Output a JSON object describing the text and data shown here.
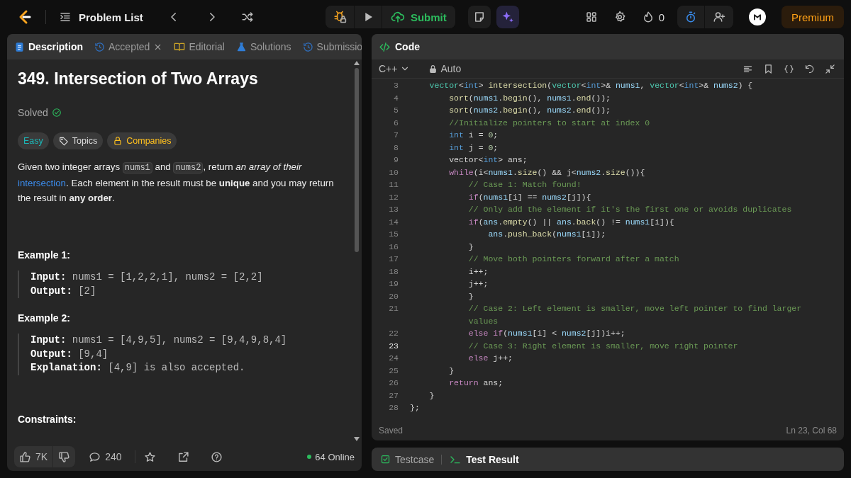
{
  "nav": {
    "problem_list": "Problem List",
    "submit": "Submit",
    "streak": "0",
    "premium": "Premium"
  },
  "description_panel": {
    "tabs": [
      {
        "label": "Description",
        "kind": "description",
        "selected": true,
        "closable": false
      },
      {
        "label": "Accepted",
        "kind": "accepted",
        "selected": false,
        "closable": true
      },
      {
        "label": "Editorial",
        "kind": "editorial",
        "selected": false,
        "closable": false
      },
      {
        "label": "Solutions",
        "kind": "solutions",
        "selected": false,
        "closable": false
      },
      {
        "label": "Submissio",
        "kind": "submissions",
        "selected": false,
        "closable": false
      }
    ],
    "title": "349. Intersection of Two Arrays",
    "status": "Solved",
    "tags": [
      {
        "label": "Easy",
        "kind": "difficulty"
      },
      {
        "label": "Topics",
        "kind": "topics"
      },
      {
        "label": "Companies",
        "kind": "companies"
      }
    ],
    "statement": [
      {
        "kind": "text",
        "text": "Given two integer arrays "
      },
      {
        "kind": "code",
        "text": "nums1"
      },
      {
        "kind": "text",
        "text": " and "
      },
      {
        "kind": "code",
        "text": "nums2"
      },
      {
        "kind": "text",
        "text": ", return *an array of their* "
      },
      {
        "kind": "link",
        "text": "intersection"
      },
      {
        "kind": "text",
        "text": ". Each element in the result must be **unique** and you may return the result in **any order**."
      }
    ],
    "examples": [
      {
        "heading": "Example 1:",
        "lines": [
          "**Input:** nums1 = [1,2,2,1], nums2 = [2,2]",
          "**Output:** [2]"
        ]
      },
      {
        "heading": "Example 2:",
        "lines": [
          "**Input:** nums1 = [4,9,5], nums2 = [9,4,9,8,4]",
          "**Output:** [9,4]",
          "**Explanation:** [4,9] is also accepted."
        ]
      }
    ],
    "constraints_heading": "Constraints:",
    "footer": {
      "likes": "7K",
      "comments": "240",
      "online": "64 Online"
    }
  },
  "code_panel": {
    "tab": "Code",
    "language": "C++",
    "mode": "Auto",
    "status": "Saved",
    "cursor": "Ln 23, Col 68",
    "lines": [
      {
        "number": "3",
        "active": false,
        "tokens": [
          {
            "text": "    vector",
            "kind": "type"
          },
          {
            "text": "<",
            "kind": "plain"
          },
          {
            "text": "int",
            "kind": "keyword"
          },
          {
            "text": "> ",
            "kind": "plain"
          },
          {
            "text": "intersection",
            "kind": "function"
          },
          {
            "text": "(",
            "kind": "plain"
          },
          {
            "text": "vector",
            "kind": "type"
          },
          {
            "text": "<",
            "kind": "plain"
          },
          {
            "text": "int",
            "kind": "keyword"
          },
          {
            "text": ">& ",
            "kind": "plain"
          },
          {
            "text": "nums1",
            "kind": "variable"
          },
          {
            "text": ", ",
            "kind": "plain"
          },
          {
            "text": "vector",
            "kind": "type"
          },
          {
            "text": "<",
            "kind": "plain"
          },
          {
            "text": "int",
            "kind": "keyword"
          },
          {
            "text": ">& ",
            "kind": "plain"
          },
          {
            "text": "nums2",
            "kind": "variable"
          },
          {
            "text": ") {",
            "kind": "plain"
          }
        ]
      },
      {
        "number": "4",
        "active": false,
        "tokens": [
          {
            "text": "        sort",
            "kind": "function"
          },
          {
            "text": "(",
            "kind": "plain"
          },
          {
            "text": "nums1",
            "kind": "variable"
          },
          {
            "text": ".",
            "kind": "plain"
          },
          {
            "text": "begin",
            "kind": "function"
          },
          {
            "text": "(), ",
            "kind": "plain"
          },
          {
            "text": "nums1",
            "kind": "variable"
          },
          {
            "text": ".",
            "kind": "plain"
          },
          {
            "text": "end",
            "kind": "function"
          },
          {
            "text": "());",
            "kind": "plain"
          }
        ]
      },
      {
        "number": "5",
        "active": false,
        "tokens": [
          {
            "text": "        sort",
            "kind": "function"
          },
          {
            "text": "(",
            "kind": "plain"
          },
          {
            "text": "nums2",
            "kind": "variable"
          },
          {
            "text": ".",
            "kind": "plain"
          },
          {
            "text": "begin",
            "kind": "function"
          },
          {
            "text": "(), ",
            "kind": "plain"
          },
          {
            "text": "nums2",
            "kind": "variable"
          },
          {
            "text": ".",
            "kind": "plain"
          },
          {
            "text": "end",
            "kind": "function"
          },
          {
            "text": "());",
            "kind": "plain"
          }
        ]
      },
      {
        "number": "6",
        "active": false,
        "tokens": [
          {
            "text": "        //Initialize pointers to start at index 0",
            "kind": "comment"
          }
        ]
      },
      {
        "number": "7",
        "active": false,
        "tokens": [
          {
            "text": "        int",
            "kind": "keyword"
          },
          {
            "text": " i = ",
            "kind": "plain"
          },
          {
            "text": "0",
            "kind": "number"
          },
          {
            "text": ";",
            "kind": "plain"
          }
        ]
      },
      {
        "number": "8",
        "active": false,
        "tokens": [
          {
            "text": "        int",
            "kind": "keyword"
          },
          {
            "text": " j = ",
            "kind": "plain"
          },
          {
            "text": "0",
            "kind": "number"
          },
          {
            "text": ";",
            "kind": "plain"
          }
        ]
      },
      {
        "number": "9",
        "active": false,
        "tokens": [
          {
            "text": "        vector<",
            "kind": "plain"
          },
          {
            "text": "int",
            "kind": "keyword"
          },
          {
            "text": "> ans;",
            "kind": "plain"
          }
        ]
      },
      {
        "number": "10",
        "active": false,
        "tokens": [
          {
            "text": "        while",
            "kind": "control"
          },
          {
            "text": "(i<",
            "kind": "plain"
          },
          {
            "text": "nums1",
            "kind": "variable"
          },
          {
            "text": ".",
            "kind": "plain"
          },
          {
            "text": "size",
            "kind": "function"
          },
          {
            "text": "() && j<",
            "kind": "plain"
          },
          {
            "text": "nums2",
            "kind": "variable"
          },
          {
            "text": ".",
            "kind": "plain"
          },
          {
            "text": "size",
            "kind": "function"
          },
          {
            "text": "()){",
            "kind": "plain"
          }
        ]
      },
      {
        "number": "11",
        "active": false,
        "tokens": [
          {
            "text": "            // Case 1: Match found!",
            "kind": "comment"
          }
        ]
      },
      {
        "number": "12",
        "active": false,
        "tokens": [
          {
            "text": "            if",
            "kind": "control"
          },
          {
            "text": "(",
            "kind": "plain"
          },
          {
            "text": "nums1",
            "kind": "variable"
          },
          {
            "text": "[i] == ",
            "kind": "plain"
          },
          {
            "text": "nums2",
            "kind": "variable"
          },
          {
            "text": "[j]){",
            "kind": "plain"
          }
        ]
      },
      {
        "number": "13",
        "active": false,
        "tokens": [
          {
            "text": "            // Only add the element if it's the first one or avoids duplicates",
            "kind": "comment"
          }
        ]
      },
      {
        "number": "14",
        "active": false,
        "tokens": [
          {
            "text": "            if",
            "kind": "control"
          },
          {
            "text": "(",
            "kind": "plain"
          },
          {
            "text": "ans",
            "kind": "variable"
          },
          {
            "text": ".",
            "kind": "plain"
          },
          {
            "text": "empty",
            "kind": "function"
          },
          {
            "text": "() || ",
            "kind": "plain"
          },
          {
            "text": "ans",
            "kind": "variable"
          },
          {
            "text": ".",
            "kind": "plain"
          },
          {
            "text": "back",
            "kind": "function"
          },
          {
            "text": "() != ",
            "kind": "plain"
          },
          {
            "text": "nums1",
            "kind": "variable"
          },
          {
            "text": "[i]){",
            "kind": "plain"
          }
        ]
      },
      {
        "number": "15",
        "active": false,
        "tokens": [
          {
            "text": "                ans",
            "kind": "variable"
          },
          {
            "text": ".",
            "kind": "plain"
          },
          {
            "text": "push_back",
            "kind": "function"
          },
          {
            "text": "(",
            "kind": "plain"
          },
          {
            "text": "nums1",
            "kind": "variable"
          },
          {
            "text": "[i]);",
            "kind": "plain"
          }
        ]
      },
      {
        "number": "16",
        "active": false,
        "tokens": [
          {
            "text": "            }",
            "kind": "plain"
          }
        ]
      },
      {
        "number": "17",
        "active": false,
        "tokens": [
          {
            "text": "            // Move both pointers forward after a match",
            "kind": "comment"
          }
        ]
      },
      {
        "number": "18",
        "active": false,
        "tokens": [
          {
            "text": "            i++;",
            "kind": "plain"
          }
        ]
      },
      {
        "number": "19",
        "active": false,
        "tokens": [
          {
            "text": "            j++;",
            "kind": "plain"
          }
        ]
      },
      {
        "number": "20",
        "active": false,
        "tokens": [
          {
            "text": "            }",
            "kind": "plain"
          }
        ]
      },
      {
        "number": "21",
        "active": false,
        "tokens": [
          {
            "text": "            // Case 2: Left element is smaller, move left pointer to find larger values",
            "kind": "comment"
          }
        ]
      },
      {
        "number": "22",
        "active": false,
        "tokens": [
          {
            "text": "            else if",
            "kind": "control"
          },
          {
            "text": "(",
            "kind": "plain"
          },
          {
            "text": "nums1",
            "kind": "variable"
          },
          {
            "text": "[i] < ",
            "kind": "plain"
          },
          {
            "text": "nums2",
            "kind": "variable"
          },
          {
            "text": "[j])i++;",
            "kind": "plain"
          }
        ]
      },
      {
        "number": "23",
        "active": true,
        "tokens": [
          {
            "text": "            // Case 3: Right element is smaller, move right pointer",
            "kind": "comment"
          }
        ]
      },
      {
        "number": "24",
        "active": false,
        "tokens": [
          {
            "text": "            else",
            "kind": "control"
          },
          {
            "text": " j++;",
            "kind": "plain"
          }
        ]
      },
      {
        "number": "25",
        "active": false,
        "tokens": [
          {
            "text": "        }",
            "kind": "plain"
          }
        ]
      },
      {
        "number": "26",
        "active": false,
        "tokens": [
          {
            "text": "        return",
            "kind": "control"
          },
          {
            "text": " ans;",
            "kind": "plain"
          }
        ]
      },
      {
        "number": "27",
        "active": false,
        "tokens": [
          {
            "text": "    }",
            "kind": "plain"
          }
        ]
      },
      {
        "number": "28",
        "active": false,
        "tokens": [
          {
            "text": "};",
            "kind": "plain"
          }
        ]
      }
    ]
  },
  "bottom_panel": {
    "tabs": [
      {
        "label": "Testcase",
        "kind": "testcase",
        "selected": false
      },
      {
        "label": "Test Result",
        "kind": "result",
        "selected": true
      }
    ]
  }
}
